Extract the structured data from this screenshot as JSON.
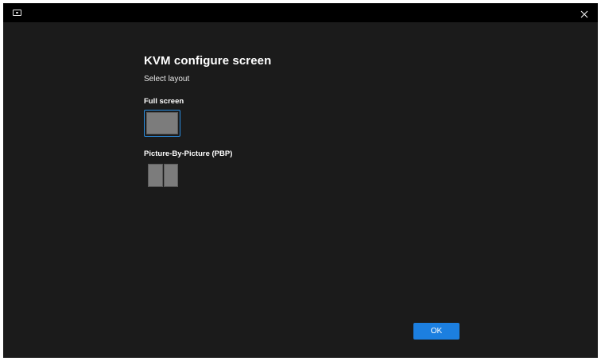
{
  "titlebar": {
    "app_icon": "monitor-icon",
    "close_icon": "close-icon"
  },
  "main": {
    "title": "KVM configure screen",
    "subtitle": "Select layout",
    "layouts": [
      {
        "label": "Full screen",
        "icon": "full-screen-layout-icon",
        "selected": true
      },
      {
        "label": "Picture-By-Picture (PBP)",
        "icon": "pbp-layout-icon",
        "selected": false
      }
    ]
  },
  "footer": {
    "ok_label": "OK"
  },
  "colors": {
    "accent": "#1c7fe0",
    "background": "#1b1b1b",
    "titlebar": "#000000"
  }
}
